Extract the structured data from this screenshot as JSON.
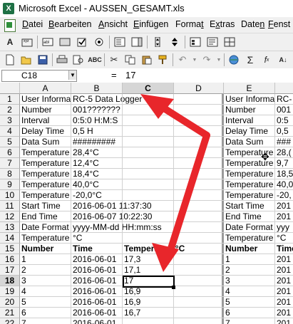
{
  "window": {
    "title": "Microsoft Excel - AUSSEN_GESAMT.xls"
  },
  "menu": [
    {
      "pre": "",
      "u": "D",
      "post": "atei"
    },
    {
      "pre": "",
      "u": "B",
      "post": "earbeiten"
    },
    {
      "pre": "",
      "u": "A",
      "post": "nsicht"
    },
    {
      "pre": "",
      "u": "E",
      "post": "infügen"
    },
    {
      "pre": "Forma",
      "u": "t",
      "post": ""
    },
    {
      "pre": "E",
      "u": "x",
      "post": "tras"
    },
    {
      "pre": "Date",
      "u": "n",
      "post": ""
    },
    {
      "pre": "",
      "u": "F",
      "post": "enst"
    }
  ],
  "formula_bar": {
    "name_box": "C18",
    "equals": "=",
    "value": "17"
  },
  "columns_left": [
    "A",
    "B",
    "C",
    "D"
  ],
  "columns_right": [
    "E"
  ],
  "rows": [
    {
      "n": "1",
      "a": "User Informa",
      "b": "RC-5 Data Logger",
      "c": "",
      "e": "User Informa",
      "f": "RC-"
    },
    {
      "n": "2",
      "a": "Number",
      "b": "001???????",
      "c": "",
      "e": "Number",
      "f": "001"
    },
    {
      "n": "3",
      "a": "Interval",
      "b": "0:5:0 H:M:S",
      "c": "",
      "e": "Interval",
      "f": "0:5"
    },
    {
      "n": "4",
      "a": "Delay Time",
      "b": "0,5 H",
      "c": "",
      "e": "Delay Time",
      "f": "0,5"
    },
    {
      "n": "5",
      "a": "Data Sum",
      "b": "#########",
      "c": "",
      "e": "Data Sum",
      "f": "###"
    },
    {
      "n": "6",
      "a": "Temperature",
      "b": "28,4°C",
      "c": "",
      "e": "Temperature",
      "f": "28,("
    },
    {
      "n": "7",
      "a": "Temperature",
      "b": "12,4°C",
      "c": "",
      "e": "Temperature",
      "f": "9,7"
    },
    {
      "n": "8",
      "a": "Temperature",
      "b": "18,4°C",
      "c": "",
      "e": "Temperature",
      "f": "18,5"
    },
    {
      "n": "9",
      "a": "Temperature",
      "b": "40,0°C",
      "c": "",
      "e": "Temperature",
      "f": "40,0"
    },
    {
      "n": "10",
      "a": "Temperature",
      "b": "-20,0°C",
      "c": "",
      "e": "Temperature",
      "f": "-20,"
    },
    {
      "n": "11",
      "a": "Start Time",
      "b": "2016-06-01 11:37:30",
      "c": "",
      "e": "Start Time",
      "f": "201"
    },
    {
      "n": "12",
      "a": "End Time",
      "b": "2016-06-07 10:22:30",
      "c": "",
      "e": "End Time",
      "f": "201"
    },
    {
      "n": "13",
      "a": "Date Format",
      "b": "yyyy-MM-dd HH:mm:ss",
      "c": "",
      "e": "Date Format",
      "f": "yyy"
    },
    {
      "n": "14",
      "a": "Temperature",
      "b": "°C",
      "c": "",
      "e": "Temperature",
      "f": "°C"
    },
    {
      "n": "15",
      "a": "Number",
      "b": "Time",
      "c": "Temperature°C",
      "e": "Number",
      "f": "Time",
      "bold": true
    },
    {
      "n": "16",
      "a": "1",
      "b": "2016-06-01",
      "c": "17,3",
      "e": "1",
      "f": "201"
    },
    {
      "n": "17",
      "a": "2",
      "b": "2016-06-01",
      "c": "17,1",
      "e": "2",
      "f": "201"
    },
    {
      "n": "18",
      "a": "3",
      "b": "2016-06-01",
      "c": "17",
      "e": "3",
      "f": "201"
    },
    {
      "n": "19",
      "a": "4",
      "b": "2016-06-01",
      "c": "16,9",
      "e": "4",
      "f": "201"
    },
    {
      "n": "20",
      "a": "5",
      "b": "2016-06-01",
      "c": "16,9",
      "e": "5",
      "f": "201"
    },
    {
      "n": "21",
      "a": "6",
      "b": "2016-06-01",
      "c": "16,7",
      "e": "6",
      "f": "201"
    },
    {
      "n": "22",
      "a": "7",
      "b": "2016-06-01",
      "c": "",
      "e": "7",
      "f": "201"
    }
  ],
  "colors": {
    "annotation_arrow": "#e8262b",
    "selection": "#000000",
    "header_bg": "#f0f0f0"
  },
  "icons": [
    "excel-app-icon",
    "new-icon",
    "open-icon",
    "save-icon",
    "print-icon",
    "preview-icon",
    "spell-icon",
    "cut-icon",
    "copy-icon",
    "paste-icon",
    "format-painter-icon",
    "undo-icon",
    "redo-icon",
    "hyperlink-icon",
    "autosum-icon",
    "function-icon",
    "sort-icon"
  ]
}
